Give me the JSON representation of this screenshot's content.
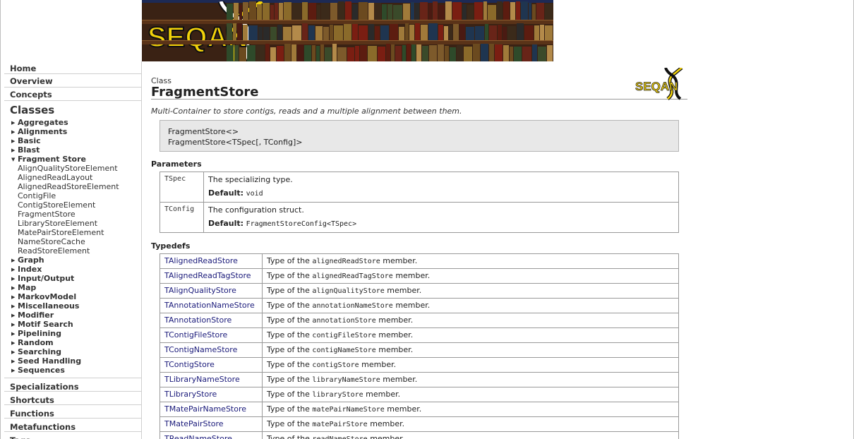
{
  "sidebar": {
    "top_links": [
      "Home",
      "Overview",
      "Concepts"
    ],
    "classes_heading": "Classes",
    "tree": [
      {
        "label": "Aggregates",
        "expanded": false
      },
      {
        "label": "Alignments",
        "expanded": false
      },
      {
        "label": "Basic",
        "expanded": false
      },
      {
        "label": "Blast",
        "expanded": false
      },
      {
        "label": "Fragment Store",
        "expanded": true,
        "children": [
          "AlignQualityStoreElement",
          "AlignedReadLayout",
          "AlignedReadStoreElement",
          "ContigFile",
          "ContigStoreElement",
          "FragmentStore",
          "LibraryStoreElement",
          "MatePairStoreElement",
          "NameStoreCache",
          "ReadStoreElement"
        ]
      },
      {
        "label": "Graph",
        "expanded": false
      },
      {
        "label": "Index",
        "expanded": false
      },
      {
        "label": "Input/Output",
        "expanded": false
      },
      {
        "label": "Map",
        "expanded": false
      },
      {
        "label": "MarkovModel",
        "expanded": false
      },
      {
        "label": "Miscellaneous",
        "expanded": false
      },
      {
        "label": "Modifier",
        "expanded": false
      },
      {
        "label": "Motif Search",
        "expanded": false
      },
      {
        "label": "Pipelining",
        "expanded": false
      },
      {
        "label": "Random",
        "expanded": false
      },
      {
        "label": "Searching",
        "expanded": false
      },
      {
        "label": "Seed Handling",
        "expanded": false
      },
      {
        "label": "Sequences",
        "expanded": false
      }
    ],
    "bottom_links": [
      "Specializations",
      "Shortcuts",
      "Functions",
      "Metafunctions",
      "Tags"
    ]
  },
  "banner": {
    "logo_text": "SEQAN"
  },
  "main": {
    "kind": "Class",
    "title": "FragmentStore",
    "description": "Multi-Container to store contigs, reads and a multiple alignment between them.",
    "signature": [
      "FragmentStore<>",
      "FragmentStore<TSpec[, TConfig]>"
    ],
    "parameters_heading": "Parameters",
    "default_label": "Default:",
    "parameters": [
      {
        "name": "TSpec",
        "desc": "The specializing type.",
        "default": "void"
      },
      {
        "name": "TConfig",
        "desc": "The configuration struct.",
        "default": "FragmentStoreConfig<TSpec>"
      }
    ],
    "typedefs_heading": "Typedefs",
    "typedef_prefix": "Type of the",
    "typedef_suffix": "member.",
    "typedefs": [
      {
        "name": "TAlignedReadStore",
        "member": "alignedReadStore"
      },
      {
        "name": "TAlignedReadTagStore",
        "member": "alignedReadTagStore"
      },
      {
        "name": "TAlignQualityStore",
        "member": "alignQualityStore"
      },
      {
        "name": "TAnnotationNameStore",
        "member": "annotationNameStore"
      },
      {
        "name": "TAnnotationStore",
        "member": "annotationStore"
      },
      {
        "name": "TContigFileStore",
        "member": "contigFileStore"
      },
      {
        "name": "TContigNameStore",
        "member": "contigNameStore"
      },
      {
        "name": "TContigStore",
        "member": "contigStore"
      },
      {
        "name": "TLibraryNameStore",
        "member": "libraryNameStore"
      },
      {
        "name": "TLibraryStore",
        "member": "libraryStore"
      },
      {
        "name": "TMatePairNameStore",
        "member": "matePairNameStore"
      },
      {
        "name": "TMatePairStore",
        "member": "matePairStore"
      },
      {
        "name": "TReadNameStore",
        "member": "readNameStore"
      }
    ]
  },
  "colors": {
    "link": "#1a1a7a",
    "logo_yellow": "#f2d20a",
    "signature_bg": "#e8e8e8"
  }
}
